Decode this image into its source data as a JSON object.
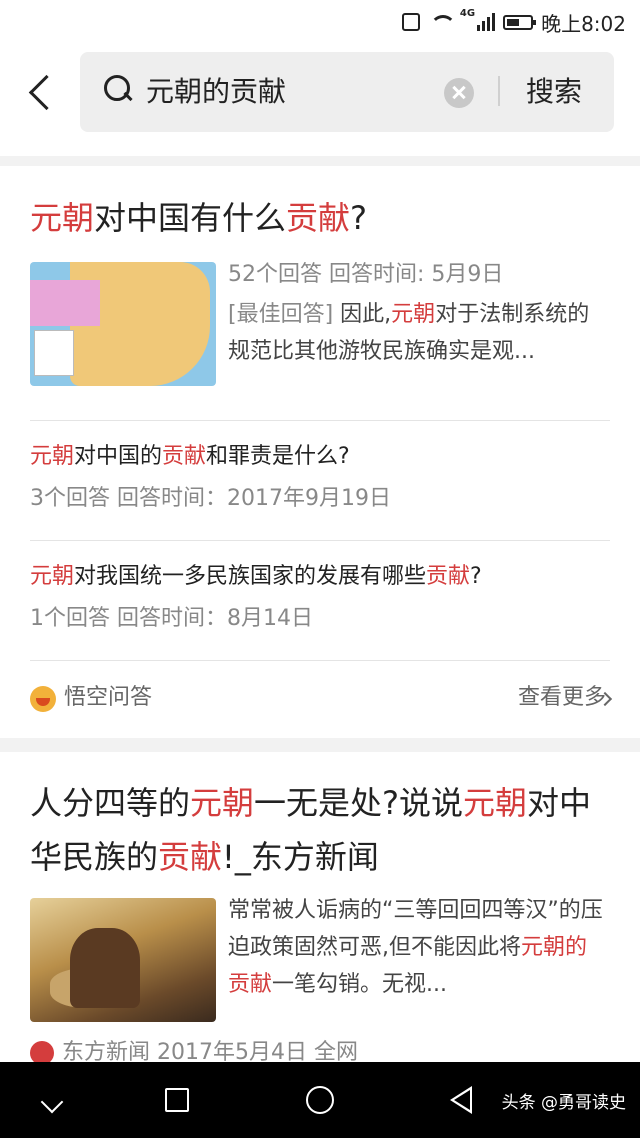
{
  "status_bar": {
    "time": "晚上8:02",
    "network": "4G"
  },
  "search": {
    "query": "元朝的贡献",
    "button": "搜索"
  },
  "card1": {
    "title": {
      "h1": "元朝",
      "t1": "对中国有什么",
      "h2": "贡献",
      "t2": "?"
    },
    "meta": "52个回答  回答时间: 5月9日",
    "snippet": {
      "bracket": "[最佳回答]",
      "t1": " 因此,",
      "h1": "元朝",
      "t2": "对于法制系统的规范比其他游牧民族确实是观..."
    },
    "questions": [
      {
        "h1": "元朝",
        "t1": "对中国的",
        "h2": "贡献",
        "t2": "和罪责是什么?",
        "meta": "3个回答    回答时间：2017年9月19日"
      },
      {
        "h1": "元朝",
        "t1": "对我国统一多民族国家的发展有哪些",
        "h2": "贡献",
        "t2": "?",
        "meta": "1个回答    回答时间：8月14日"
      }
    ],
    "source": "悟空问答",
    "more": "查看更多"
  },
  "card2": {
    "title": {
      "t1": "人分四等的",
      "h1": "元朝",
      "t2": "一无是处?说说",
      "h2": "元朝",
      "t3": "对中华民族的",
      "h3": "贡献",
      "t4": "!_东方新闻"
    },
    "snippet": {
      "t1": "常常被人诟病的“三等回回四等汉”的压迫政策固然可恶,但不能因此将",
      "h1": "元朝的贡献",
      "t2": "一笔勾销。无视..."
    },
    "source": "东方新闻  2017年5月4日  全网"
  },
  "watermark": "头条 @勇哥读史",
  "colors": {
    "highlight": "#d43d3d",
    "accent": "#f2b13a"
  }
}
